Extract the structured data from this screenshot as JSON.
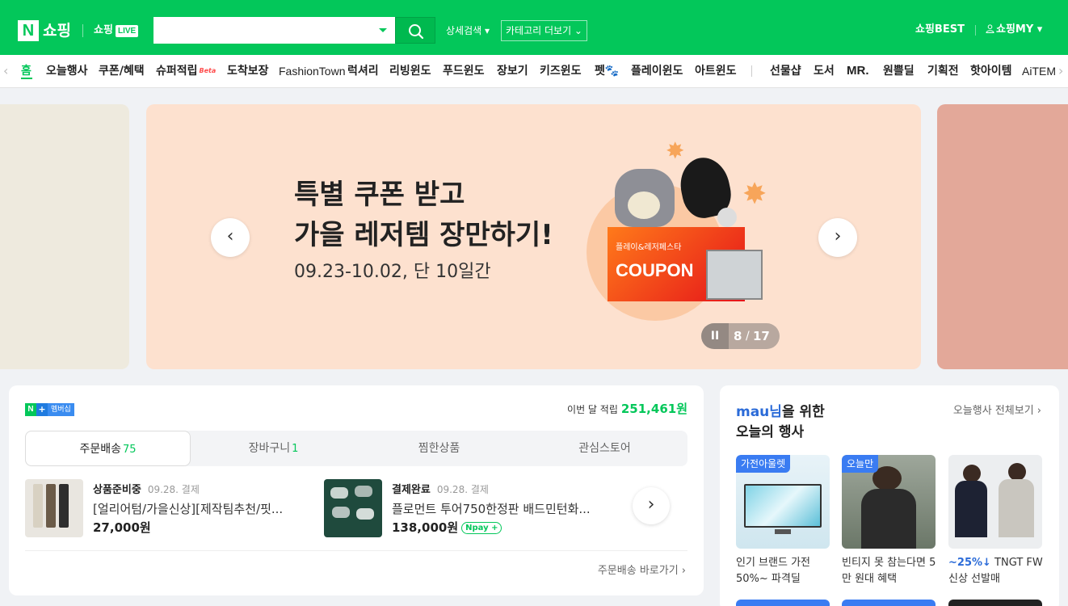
{
  "header": {
    "logo_n": "N",
    "logo_text": "쇼핑",
    "live_text": "쇼핑",
    "live_badge": "LIVE",
    "search_placeholder": "",
    "advanced_search": "상세검색 ▾",
    "category_more": "카테고리 더보기 ⌄",
    "best": "쇼핑BEST",
    "my": "쇼핑MY ▾",
    "brand_color": "#03c75a"
  },
  "catnav": {
    "items": [
      {
        "label": "홈",
        "active": true
      },
      {
        "label": "오늘행사"
      },
      {
        "label": "쿠폰/혜택"
      },
      {
        "label": "슈퍼적립",
        "badge": "Beta"
      },
      {
        "label": "도착보장"
      },
      {
        "label": "FashionTown"
      },
      {
        "label": "럭셔리"
      },
      {
        "label": "리빙윈도"
      },
      {
        "label": "푸드윈도"
      },
      {
        "label": "장보기"
      },
      {
        "label": "키즈윈도"
      },
      {
        "label": "펫🐾"
      },
      {
        "label": "플레이윈도"
      },
      {
        "label": "아트윈도"
      },
      {
        "label": "선물샵"
      },
      {
        "label": "도서"
      },
      {
        "label": "MR."
      },
      {
        "label": "원쁠딜"
      },
      {
        "label": "기획전"
      },
      {
        "label": "핫아이템"
      },
      {
        "label": "AiTEM"
      }
    ]
  },
  "banner": {
    "title_line1": "특별 쿠폰 받고",
    "title_line2": "가을 레저템 장만하기!",
    "date": "09.23-10.02, 단 10일간",
    "coupon_small": "플레이&레저페스타",
    "coupon_big": "COUPON",
    "current": "8",
    "slash": "/",
    "total": "17",
    "pause": "II",
    "prev": "‹",
    "next": "›"
  },
  "membership": {
    "n": "N",
    "plus": "+",
    "label": "멤버십",
    "points_label": "이번 달 적립",
    "points_value": "251,461원"
  },
  "order_tabs": [
    {
      "label": "주문배송",
      "count": "75",
      "active": true
    },
    {
      "label": "장바구니",
      "count": "1"
    },
    {
      "label": "찜한상품",
      "count": ""
    },
    {
      "label": "관심스토어",
      "count": ""
    }
  ],
  "orders": [
    {
      "status": "상품준비중",
      "date": "09.28. 결제",
      "name": "[얼리어텀/가을신상][제작팀추천/핏...",
      "price": "27,000원",
      "npay": ""
    },
    {
      "status": "결제완료",
      "date": "09.28. 결제",
      "name": "플로먼트 투어750한정판 배드민턴화...",
      "price": "138,000원",
      "npay": "Npay +"
    }
  ],
  "order_next": "›",
  "order_link": "주문배송 바로가기 ›",
  "events": {
    "user": "mau님",
    "title_suffix": "을 위한",
    "title_line2": "오늘의 행사",
    "all_link": "오늘행사 전체보기 ›",
    "items": [
      {
        "tag": "가전아울렛",
        "desc": "인기 브랜드 가전 50%~ 파격딜",
        "discount": ""
      },
      {
        "tag": "오늘만",
        "desc": "빈티지 못 참는다면 5만 원대 혜택",
        "discount": ""
      },
      {
        "tag": "",
        "desc": " TNGT FW 신상 선발매",
        "discount": "~25%↓"
      }
    ]
  }
}
